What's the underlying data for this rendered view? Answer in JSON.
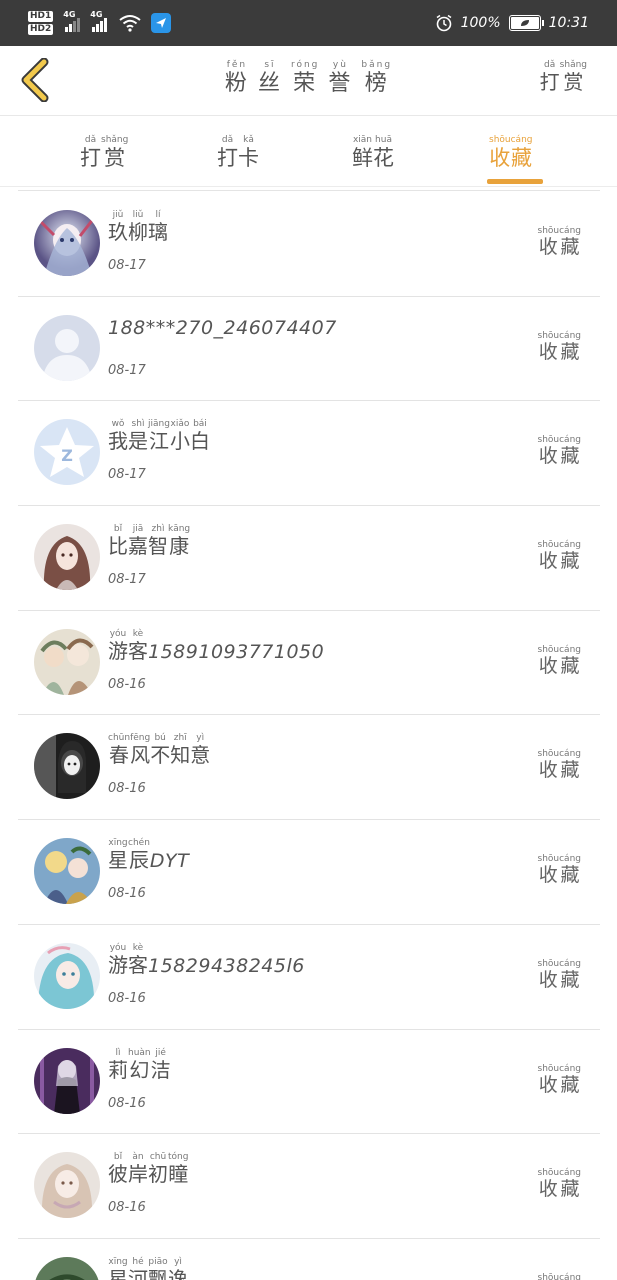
{
  "status_bar": {
    "hd1": "HD1",
    "hd2": "HD2",
    "net1": "4G",
    "net2": "4G",
    "battery_text": "100%",
    "time": "10:31",
    "bg": "#3b3b3b"
  },
  "header": {
    "back_icon": "chevron-left-icon",
    "title_chars": [
      {
        "han": "粉",
        "pin": "fěn"
      },
      {
        "han": "丝",
        "pin": "sī"
      },
      {
        "han": "荣",
        "pin": "róng"
      },
      {
        "han": "誉",
        "pin": "yù"
      },
      {
        "han": "榜",
        "pin": "bǎng"
      }
    ],
    "reward_chars": [
      {
        "han": "打",
        "pin": "dǎ"
      },
      {
        "han": "赏",
        "pin": "shǎng"
      }
    ]
  },
  "tabs": [
    {
      "chars": [
        {
          "han": "打",
          "pin": "dǎ"
        },
        {
          "han": "赏",
          "pin": "shǎng"
        }
      ],
      "active": false
    },
    {
      "chars": [
        {
          "han": "打",
          "pin": "dǎ"
        },
        {
          "han": "卡",
          "pin": "kǎ"
        }
      ],
      "active": false
    },
    {
      "chars": [
        {
          "han": "鲜",
          "pin": "xiān"
        },
        {
          "han": "花",
          "pin": "huā"
        }
      ],
      "active": false
    },
    {
      "chars": [
        {
          "han": "收",
          "pin": "shōu"
        },
        {
          "han": "藏",
          "pin": "cáng"
        }
      ],
      "active": true
    }
  ],
  "accent_color": "#e8a23b",
  "action_chars": [
    {
      "han": "收",
      "pin": "shōu"
    },
    {
      "han": "藏",
      "pin": "cáng"
    }
  ],
  "rows": [
    {
      "name": [
        {
          "han": "玖",
          "pin": "jiǔ"
        },
        {
          "han": "柳",
          "pin": "liǔ"
        },
        {
          "han": "璃",
          "pin": "lí"
        }
      ],
      "date": "08-17",
      "avatar": "anime-girl-blue-white"
    },
    {
      "name": [
        {
          "latin": "188***270_246074407"
        }
      ],
      "date": "08-17",
      "avatar": "default-user-avatar"
    },
    {
      "name": [
        {
          "han": "我",
          "pin": "wǒ"
        },
        {
          "han": "是",
          "pin": "shì"
        },
        {
          "han": "江",
          "pin": "jiāng"
        },
        {
          "han": "小",
          "pin": "xiǎo"
        },
        {
          "han": "白",
          "pin": "bái"
        }
      ],
      "date": "08-17",
      "avatar": "qq-star-avatar"
    },
    {
      "name": [
        {
          "han": "比",
          "pin": "bǐ"
        },
        {
          "han": "嘉",
          "pin": "jiā"
        },
        {
          "han": "智",
          "pin": "zhì"
        },
        {
          "han": "康",
          "pin": "kāng"
        }
      ],
      "date": "08-17",
      "avatar": "anime-girl-brown-hair"
    },
    {
      "name": [
        {
          "han": "游",
          "pin": "yóu"
        },
        {
          "han": "客",
          "pin": "kè"
        },
        {
          "latin": "15891093771050"
        }
      ],
      "date": "08-16",
      "avatar": "anime-group-pastel"
    },
    {
      "name": [
        {
          "han": "春",
          "pin": "chūn"
        },
        {
          "han": "风",
          "pin": "fēng"
        },
        {
          "han": "不",
          "pin": "bú"
        },
        {
          "han": "知",
          "pin": "zhī"
        },
        {
          "han": "意",
          "pin": "yì"
        }
      ],
      "date": "08-16",
      "avatar": "anime-dark-monochrome"
    },
    {
      "name": [
        {
          "han": "星",
          "pin": "xīng"
        },
        {
          "han": "辰",
          "pin": "chén"
        },
        {
          "latin": "DYT"
        }
      ],
      "date": "08-16",
      "avatar": "anime-colorful-characters"
    },
    {
      "name": [
        {
          "han": "游",
          "pin": "yóu"
        },
        {
          "han": "客",
          "pin": "kè"
        },
        {
          "latin": "15829438245l6"
        }
      ],
      "date": "08-16",
      "avatar": "anime-teal-hair"
    },
    {
      "name": [
        {
          "han": "莉",
          "pin": "lì"
        },
        {
          "han": "幻",
          "pin": "huàn"
        },
        {
          "han": "洁",
          "pin": "jié"
        }
      ],
      "date": "08-16",
      "avatar": "anime-purple-stage"
    },
    {
      "name": [
        {
          "han": "彼",
          "pin": "bǐ"
        },
        {
          "han": "岸",
          "pin": "àn"
        },
        {
          "han": "初",
          "pin": "chū"
        },
        {
          "han": "瞳",
          "pin": "tóng"
        }
      ],
      "date": "08-16",
      "avatar": "anime-soft-pink"
    },
    {
      "name": [
        {
          "han": "星",
          "pin": "xīng"
        },
        {
          "han": "河",
          "pin": "hé"
        },
        {
          "han": "飘",
          "pin": "piāo"
        },
        {
          "han": "逸",
          "pin": "yì"
        }
      ],
      "date": "",
      "avatar": "anime-green-partial"
    }
  ]
}
